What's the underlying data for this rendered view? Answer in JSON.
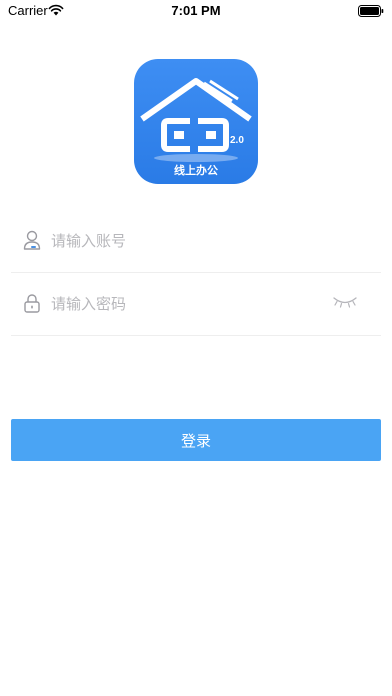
{
  "status_bar": {
    "carrier": "Carrier",
    "time": "7:01 PM",
    "wifi_icon": "wifi-icon",
    "battery_icon": "battery-icon"
  },
  "logo": {
    "version": "2.0",
    "caption": "线上办公",
    "background_color": "#3085ee"
  },
  "account_field": {
    "icon": "user-icon",
    "placeholder": "请输入账号",
    "value": ""
  },
  "password_field": {
    "icon": "lock-icon",
    "placeholder": "请输入密码",
    "value": "",
    "toggle_icon": "eye-closed-icon"
  },
  "login_button": {
    "label": "登录",
    "color": "#4aa4f4"
  }
}
